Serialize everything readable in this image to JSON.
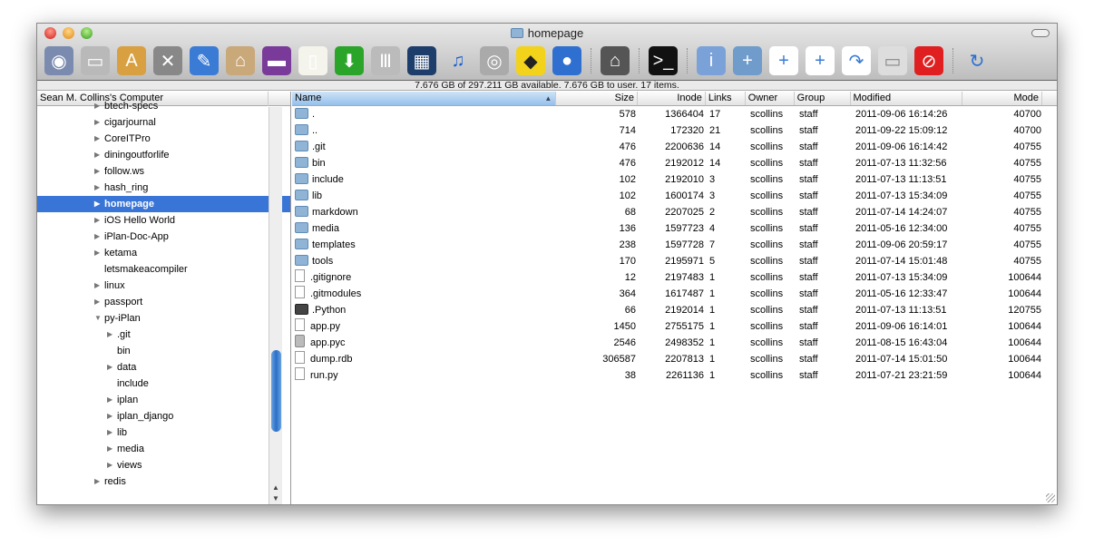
{
  "window": {
    "title": "homepage",
    "status": "7.676 GB of 297.211 GB available. 7.676 GB to user. 17 items."
  },
  "toolbar": [
    {
      "icon": "network-globe-icon",
      "bg": "#7b8bb0",
      "g": "◉"
    },
    {
      "icon": "hard-drive-icon",
      "bg": "#b9b9b9",
      "g": "▭"
    },
    {
      "icon": "applications-icon",
      "bg": "#d8a040",
      "g": "A"
    },
    {
      "icon": "utilities-icon",
      "bg": "#888",
      "g": "✕"
    },
    {
      "icon": "xcode-icon",
      "bg": "#3a7bd5",
      "g": "✎"
    },
    {
      "icon": "home-icon",
      "bg": "#c9a87a",
      "g": "⌂"
    },
    {
      "icon": "desktop-icon",
      "bg": "#7a3a9a",
      "g": "▬"
    },
    {
      "icon": "documents-icon",
      "bg": "#f4f4ec",
      "g": "▯"
    },
    {
      "icon": "downloads-icon",
      "bg": "#2aa52a",
      "g": "⬇"
    },
    {
      "icon": "library-icon",
      "bg": "#bbb",
      "g": "Ⅲ"
    },
    {
      "icon": "movies-icon",
      "bg": "#1d3d6a",
      "g": "▦"
    },
    {
      "icon": "music-icon",
      "bg": "transparent",
      "g": "♫",
      "c": "#1a5fd0"
    },
    {
      "icon": "pictures-icon",
      "bg": "#aaa",
      "g": "◎"
    },
    {
      "icon": "public-icon",
      "bg": "#f2d21a",
      "g": "◆",
      "c": "#222"
    },
    {
      "icon": "sites-icon",
      "bg": "#2f6fcf",
      "g": "●"
    },
    {
      "sep": true
    },
    {
      "icon": "home-folder-icon",
      "bg": "#555",
      "g": "⌂"
    },
    {
      "sep": true
    },
    {
      "icon": "terminal-icon",
      "bg": "#111",
      "g": ">_"
    },
    {
      "sep": true
    },
    {
      "icon": "info-icon",
      "bg": "#7aa2d8",
      "g": "i"
    },
    {
      "icon": "new-folder-icon",
      "bg": "#6f9ccb",
      "g": "+"
    },
    {
      "icon": "copy-icon",
      "bg": "#fff",
      "g": "+",
      "c": "#3a7bd5"
    },
    {
      "icon": "duplicate-icon",
      "bg": "#fff",
      "g": "+",
      "c": "#3a7bd5"
    },
    {
      "icon": "move-icon",
      "bg": "#fff",
      "g": "↷",
      "c": "#3a7bd5"
    },
    {
      "icon": "unix-file-icon",
      "bg": "#ddd",
      "g": "▭",
      "c": "#888"
    },
    {
      "icon": "delete-icon",
      "bg": "#e02020",
      "g": "⊘"
    },
    {
      "sep": true
    },
    {
      "icon": "refresh-icon",
      "bg": "transparent",
      "g": "↻",
      "c": "#2a6fd0"
    }
  ],
  "sidebar": {
    "header": "Sean M. Collins's Computer",
    "items": [
      {
        "label": "btech-specs",
        "level": 1,
        "arrow": "▶"
      },
      {
        "label": "cigarjournal",
        "level": 1,
        "arrow": "▶"
      },
      {
        "label": "CoreITPro",
        "level": 1,
        "arrow": "▶"
      },
      {
        "label": "diningoutforlife",
        "level": 1,
        "arrow": "▶"
      },
      {
        "label": "follow.ws",
        "level": 1,
        "arrow": "▶"
      },
      {
        "label": "hash_ring",
        "level": 1,
        "arrow": "▶"
      },
      {
        "label": "homepage",
        "level": 1,
        "arrow": "▶",
        "selected": true
      },
      {
        "label": "iOS Hello World",
        "level": 1,
        "arrow": "▶"
      },
      {
        "label": "iPlan-Doc-App",
        "level": 1,
        "arrow": "▶"
      },
      {
        "label": "ketama",
        "level": 1,
        "arrow": "▶"
      },
      {
        "label": "letsmakeacompiler",
        "level": 1,
        "arrow": ""
      },
      {
        "label": "linux",
        "level": 1,
        "arrow": "▶"
      },
      {
        "label": "passport",
        "level": 1,
        "arrow": "▶"
      },
      {
        "label": "py-iPlan",
        "level": 1,
        "arrow": "▼"
      },
      {
        "label": ".git",
        "level": 2,
        "arrow": "▶"
      },
      {
        "label": "bin",
        "level": 2,
        "arrow": ""
      },
      {
        "label": "data",
        "level": 2,
        "arrow": "▶"
      },
      {
        "label": "include",
        "level": 2,
        "arrow": ""
      },
      {
        "label": "iplan",
        "level": 2,
        "arrow": "▶"
      },
      {
        "label": "iplan_django",
        "level": 2,
        "arrow": "▶"
      },
      {
        "label": "lib",
        "level": 2,
        "arrow": "▶"
      },
      {
        "label": "media",
        "level": 2,
        "arrow": "▶"
      },
      {
        "label": "views",
        "level": 2,
        "arrow": "▶"
      },
      {
        "label": "redis",
        "level": 1,
        "arrow": "▶"
      }
    ]
  },
  "table": {
    "columns": [
      "Name",
      "Size",
      "Inode",
      "Links",
      "Owner",
      "Group",
      "Modified",
      "Mode"
    ],
    "sort_indicator": "▲",
    "rows": [
      {
        "type": "folder",
        "name": ".",
        "size": "578",
        "inode": "1366404",
        "links": "17",
        "owner": "scollins",
        "group": "staff",
        "modified": "2011-09-06 16:14:26",
        "mode": "40700"
      },
      {
        "type": "folder",
        "name": "..",
        "size": "714",
        "inode": "172320",
        "links": "21",
        "owner": "scollins",
        "group": "staff",
        "modified": "2011-09-22 15:09:12",
        "mode": "40700"
      },
      {
        "type": "folder",
        "name": ".git",
        "size": "476",
        "inode": "2200636",
        "links": "14",
        "owner": "scollins",
        "group": "staff",
        "modified": "2011-09-06 16:14:42",
        "mode": "40755"
      },
      {
        "type": "folder",
        "name": "bin",
        "size": "476",
        "inode": "2192012",
        "links": "14",
        "owner": "scollins",
        "group": "staff",
        "modified": "2011-07-13 11:32:56",
        "mode": "40755"
      },
      {
        "type": "folder",
        "name": "include",
        "size": "102",
        "inode": "2192010",
        "links": "3",
        "owner": "scollins",
        "group": "staff",
        "modified": "2011-07-13 11:13:51",
        "mode": "40755"
      },
      {
        "type": "folder",
        "name": "lib",
        "size": "102",
        "inode": "1600174",
        "links": "3",
        "owner": "scollins",
        "group": "staff",
        "modified": "2011-07-13 15:34:09",
        "mode": "40755"
      },
      {
        "type": "folder",
        "name": "markdown",
        "size": "68",
        "inode": "2207025",
        "links": "2",
        "owner": "scollins",
        "group": "staff",
        "modified": "2011-07-14 14:24:07",
        "mode": "40755"
      },
      {
        "type": "folder",
        "name": "media",
        "size": "136",
        "inode": "1597723",
        "links": "4",
        "owner": "scollins",
        "group": "staff",
        "modified": "2011-05-16 12:34:00",
        "mode": "40755"
      },
      {
        "type": "folder",
        "name": "templates",
        "size": "238",
        "inode": "1597728",
        "links": "7",
        "owner": "scollins",
        "group": "staff",
        "modified": "2011-09-06 20:59:17",
        "mode": "40755"
      },
      {
        "type": "folder",
        "name": "tools",
        "size": "170",
        "inode": "2195971",
        "links": "5",
        "owner": "scollins",
        "group": "staff",
        "modified": "2011-07-14 15:01:48",
        "mode": "40755"
      },
      {
        "type": "file",
        "name": ".gitignore",
        "size": "12",
        "inode": "2197483",
        "links": "1",
        "owner": "scollins",
        "group": "staff",
        "modified": "2011-07-13 15:34:09",
        "mode": "100644"
      },
      {
        "type": "file",
        "name": ".gitmodules",
        "size": "364",
        "inode": "1617487",
        "links": "1",
        "owner": "scollins",
        "group": "staff",
        "modified": "2011-05-16 12:33:47",
        "mode": "100644"
      },
      {
        "type": "exec",
        "name": ".Python",
        "size": "66",
        "inode": "2192014",
        "links": "1",
        "owner": "scollins",
        "group": "staff",
        "modified": "2011-07-13 11:13:51",
        "mode": "120755"
      },
      {
        "type": "file",
        "name": "app.py",
        "size": "1450",
        "inode": "2755175",
        "links": "1",
        "owner": "scollins",
        "group": "staff",
        "modified": "2011-09-06 16:14:01",
        "mode": "100644"
      },
      {
        "type": "pyc",
        "name": "app.pyc",
        "size": "2546",
        "inode": "2498352",
        "links": "1",
        "owner": "scollins",
        "group": "staff",
        "modified": "2011-08-15 16:43:04",
        "mode": "100644"
      },
      {
        "type": "file",
        "name": "dump.rdb",
        "size": "306587",
        "inode": "2207813",
        "links": "1",
        "owner": "scollins",
        "group": "staff",
        "modified": "2011-07-14 15:01:50",
        "mode": "100644"
      },
      {
        "type": "file",
        "name": "run.py",
        "size": "38",
        "inode": "2261136",
        "links": "1",
        "owner": "scollins",
        "group": "staff",
        "modified": "2011-07-21 23:21:59",
        "mode": "100644"
      }
    ]
  }
}
